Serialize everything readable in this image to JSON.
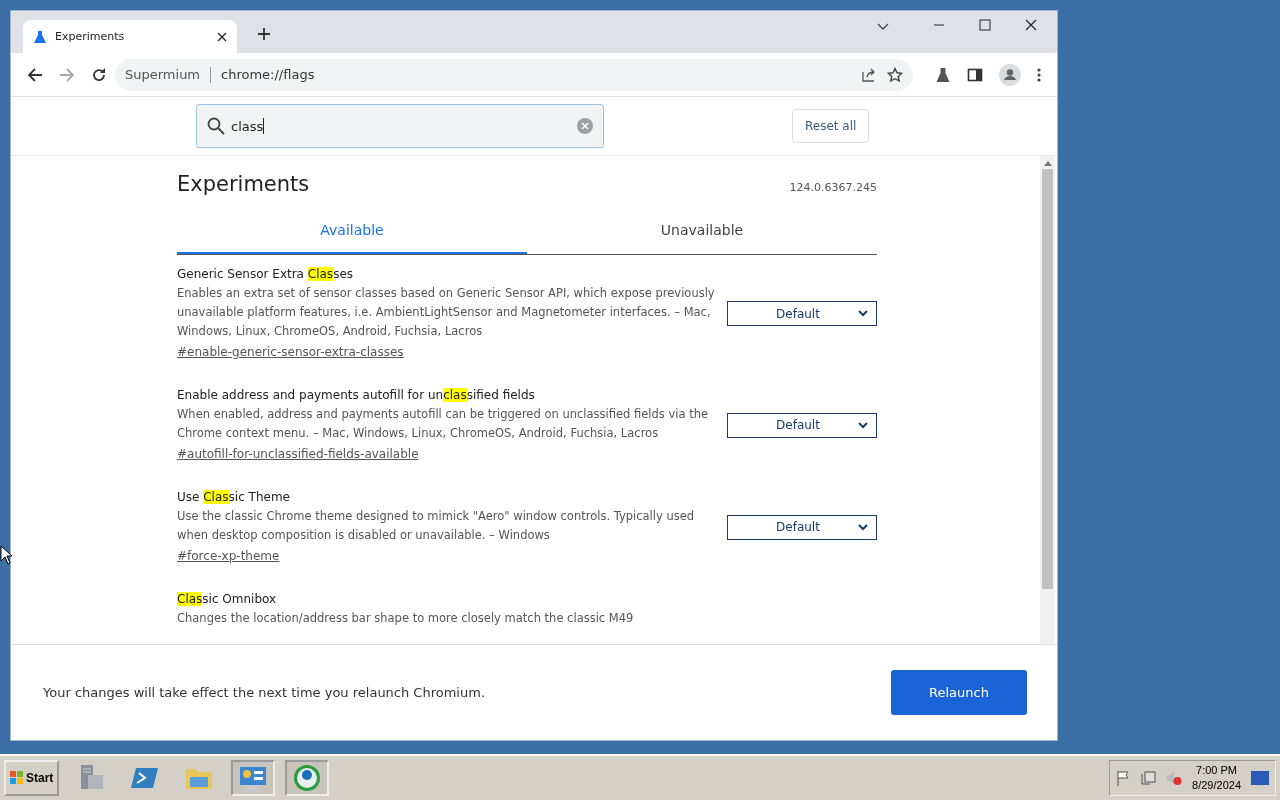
{
  "tab": {
    "title": "Experiments",
    "selected": true
  },
  "address": {
    "site": "Supermium",
    "url": "chrome://flags"
  },
  "search": {
    "value": "class"
  },
  "reset_button": "Reset all",
  "page": {
    "title": "Experiments",
    "version": "124.0.6367.245"
  },
  "view_tabs": [
    {
      "label": "Available",
      "selected": true
    },
    {
      "label": "Unavailable",
      "selected": false
    }
  ],
  "flags": [
    {
      "title": [
        {
          "text": "Generic Sensor Extra ",
          "highlighted": false
        },
        {
          "text": "Clas",
          "highlighted": true
        },
        {
          "text": "ses",
          "highlighted": false
        }
      ],
      "description": "Enables an extra set of sensor classes based on Generic Sensor API, which expose previously unavailable platform features, i.e. AmbientLightSensor and Magnetometer interfaces. – Mac, Windows, Linux, ChromeOS, Android, Fuchsia, Lacros",
      "link": "#enable-generic-sensor-extra-classes",
      "value": "Default"
    },
    {
      "title": [
        {
          "text": "Enable address and payments autofill for un",
          "highlighted": false
        },
        {
          "text": "clas",
          "highlighted": true
        },
        {
          "text": "sified fields",
          "highlighted": false
        }
      ],
      "description": "When enabled, address and payments autofill can be triggered on unclassified fields via the Chrome context menu. – Mac, Windows, Linux, ChromeOS, Android, Fuchsia, Lacros",
      "link": "#autofill-for-unclassified-fields-available",
      "value": "Default"
    },
    {
      "title": [
        {
          "text": "Use ",
          "highlighted": false
        },
        {
          "text": "Clas",
          "highlighted": true
        },
        {
          "text": "sic Theme",
          "highlighted": false
        }
      ],
      "description": "Use the classic Chrome theme designed to mimick \"Aero\" window controls. Typically used when desktop composition is disabled or unavailable. – Windows",
      "link": "#force-xp-theme",
      "value": "Default"
    },
    {
      "title": [
        {
          "text": "Clas",
          "highlighted": true
        },
        {
          "text": "sic Omnibox",
          "highlighted": false
        }
      ],
      "description": "Changes the location/address bar shape to more closely match the classic M49"
    }
  ],
  "relaunch": {
    "message": "Your changes will take effect the next time you relaunch Chromium.",
    "button": "Relaunch"
  },
  "taskbar": {
    "start": "Start",
    "apps": [
      {
        "kind": "server",
        "pressed": false
      },
      {
        "kind": "terminal",
        "pressed": false
      },
      {
        "kind": "folder",
        "pressed": false
      },
      {
        "kind": "panel",
        "pressed": true
      },
      {
        "kind": "browser",
        "pressed": true
      }
    ],
    "time": "7:00 PM",
    "date": "8/29/2024"
  }
}
